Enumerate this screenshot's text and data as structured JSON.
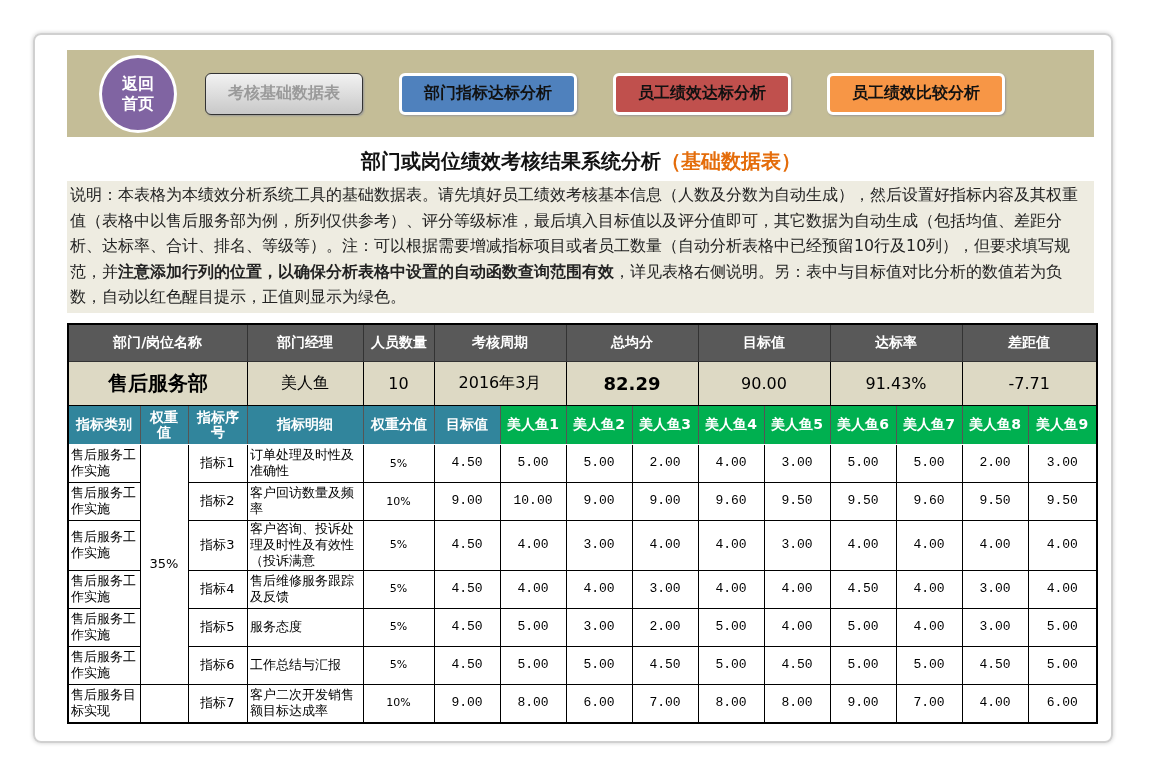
{
  "nav": {
    "buttons": [
      {
        "kind": "home",
        "label": "返回首页",
        "color": "#8064a2",
        "disabled": false
      },
      {
        "kind": "tab",
        "label": "考核基础数据表",
        "color": "#d9d9d9",
        "disabled": true
      },
      {
        "kind": "tab",
        "label": "部门指标达标分析",
        "color": "#4f81bd",
        "disabled": false
      },
      {
        "kind": "tab",
        "label": "员工绩效达标分析",
        "color": "#c0504d",
        "disabled": false
      },
      {
        "kind": "tab",
        "label": "员工绩效比较分析",
        "color": "#f79646",
        "disabled": false
      }
    ]
  },
  "title": {
    "main": "部门或岗位绩效考核结果系统分析",
    "sub": "（基础数据表）"
  },
  "note": "说明：本表格为本绩效分析系统工具的基础数据表。请先填好员工绩效考核基本信息（人数及分数为自动生成），然后设置好指标内容及其权重值（表格中以售后服务部为例，所列仅供参考）、评分等级标准，最后填入目标值以及评分值即可，其它数据为自动生成（包括均值、差距分析、达标率、合计、排名、等级等）。注：可以根据需要增减指标项目或者员工数量（自动分析表格中已经预留10行及10列），但要求填写规范，并**注意添加行列的位置，以确保分析表格中设置的自动函数查询范围有效**，详见表格右侧说明。另：表中与目标值对比分析的数值若为负数，自动以红色醒目提示，正值则显示为绿色。",
  "summary": {
    "columns": [
      "部门/岗位名称",
      "部门经理",
      "人员数量",
      "考核周期",
      "总均分",
      "目标值",
      "达标率",
      "差距值"
    ],
    "values": [
      "售后服务部",
      "美人鱼",
      "10",
      "2016年3月",
      "82.29",
      "90.00",
      "91.43%",
      "-7.71"
    ]
  },
  "table": {
    "columns": [
      "指标类别",
      "权重值",
      "指标序号",
      "指标明细",
      "权重分值",
      "目标值",
      "美人鱼1",
      "美人鱼2",
      "美人鱼3",
      "美人鱼4",
      "美人鱼5",
      "美人鱼6",
      "美人鱼7",
      "美人鱼8",
      "美人鱼9"
    ],
    "groups": [
      {
        "weight": "35%",
        "rows": [
          {
            "category": "售后服务工作实施",
            "index": "指标1",
            "detail": "订单处理及时性及准确性",
            "points": "5%",
            "target": "4.50",
            "scores": [
              "5.00",
              "5.00",
              "2.00",
              "4.00",
              "3.00",
              "5.00",
              "5.00",
              "2.00",
              "3.00"
            ]
          },
          {
            "category": "售后服务工作实施",
            "index": "指标2",
            "detail": "客户回访数量及频率",
            "points": "10%",
            "target": "9.00",
            "scores": [
              "10.00",
              "9.00",
              "9.00",
              "9.60",
              "9.50",
              "9.50",
              "9.60",
              "9.50",
              "9.50"
            ]
          },
          {
            "category": "售后服务工作实施",
            "index": "指标3",
            "detail": "客户咨询、投诉处理及时性及有效性（投诉满意",
            "points": "5%",
            "target": "4.50",
            "scores": [
              "4.00",
              "3.00",
              "4.00",
              "4.00",
              "3.00",
              "4.00",
              "4.00",
              "4.00",
              "4.00"
            ]
          },
          {
            "category": "售后服务工作实施",
            "index": "指标4",
            "detail": "售后维修服务跟踪及反馈",
            "points": "5%",
            "target": "4.50",
            "scores": [
              "4.00",
              "4.00",
              "3.00",
              "4.00",
              "4.00",
              "4.50",
              "4.00",
              "3.00",
              "4.00"
            ]
          },
          {
            "category": "售后服务工作实施",
            "index": "指标5",
            "detail": "服务态度",
            "points": "5%",
            "target": "4.50",
            "scores": [
              "5.00",
              "3.00",
              "2.00",
              "5.00",
              "4.00",
              "5.00",
              "4.00",
              "3.00",
              "5.00"
            ]
          },
          {
            "category": "售后服务工作实施",
            "index": "指标6",
            "detail": "工作总结与汇报",
            "points": "5%",
            "target": "4.50",
            "scores": [
              "5.00",
              "5.00",
              "4.50",
              "5.00",
              "4.50",
              "5.00",
              "5.00",
              "4.50",
              "5.00"
            ]
          }
        ]
      },
      {
        "rows": [
          {
            "category": "售后服务目标实现",
            "index": "指标7",
            "detail": "客户二次开发销售额目标达成率",
            "points": "10%",
            "target": "9.00",
            "scores": [
              "8.00",
              "6.00",
              "7.00",
              "8.00",
              "8.00",
              "9.00",
              "7.00",
              "4.00",
              "6.00"
            ]
          }
        ]
      }
    ]
  }
}
